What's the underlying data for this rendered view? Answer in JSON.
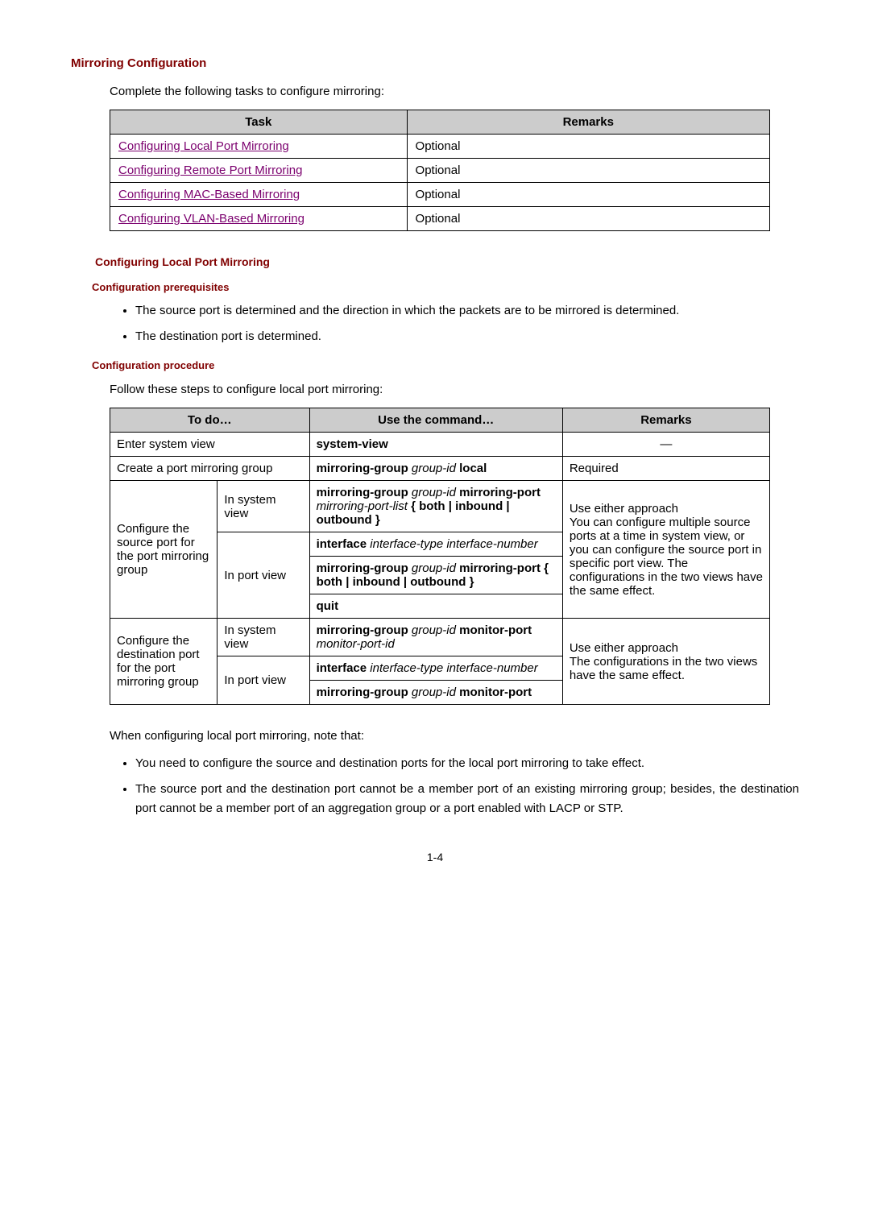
{
  "heading_config": "Mirroring Configuration",
  "intro": "Complete the following tasks to configure mirroring:",
  "tasks_table": {
    "headers": {
      "task": "Task",
      "remarks": "Remarks"
    },
    "rows": [
      {
        "task": "Configuring Local Port Mirroring",
        "remarks": "Optional"
      },
      {
        "task": "Configuring Remote Port Mirroring",
        "remarks": "Optional"
      },
      {
        "task": "Configuring MAC-Based Mirroring",
        "remarks": "Optional"
      },
      {
        "task": "Configuring VLAN-Based Mirroring",
        "remarks": "Optional"
      }
    ]
  },
  "section_local": "Configuring Local Port Mirroring",
  "prereq_heading": "Configuration prerequisites",
  "prereq_bullets": [
    "The source port is determined and the direction in which the packets are to be mirrored is determined.",
    "The destination port is determined."
  ],
  "procedure_heading": "Configuration procedure",
  "follow_text": "Follow these steps to configure local port mirroring:",
  "steps_table": {
    "headers": {
      "todo": "To do…",
      "command": "Use the command…",
      "remarks": "Remarks"
    },
    "row_enter": {
      "todo": "Enter system view",
      "cmd_kw": "system-view",
      "remarks": "—"
    },
    "row_create": {
      "todo": "Create a port mirroring group",
      "cmd_kw1": "mirroring-group",
      "cmd_arg1": "group-id",
      "cmd_kw2": "local",
      "remarks": "Required"
    },
    "row_src": {
      "todo": "Configure the source port for the port mirroring group",
      "sys_view": "In system view",
      "port_view": "In port view",
      "sys_cmd": {
        "kw1": "mirroring-group",
        "arg1": "group-id",
        "kw2": "mirroring-port",
        "arg2": "mirroring-port-list",
        "tail": "{ both | inbound | outbound }"
      },
      "port_iface": {
        "kw": "interface",
        "arg": "interface-type interface-number"
      },
      "port_cmd": {
        "kw1": "mirroring-group",
        "arg1": "group-id",
        "kw2": "mirroring-port",
        "tail": "{ both | inbound | outbound }"
      },
      "quit": "quit",
      "remarks": "Use either approach\nYou can configure multiple source ports at a time in system view, or you can configure the source port in specific port view. The configurations in the two views have the same effect."
    },
    "row_dst": {
      "todo": "Configure the destination port for the port mirroring group",
      "sys_view": "In system view",
      "port_view": "In port view",
      "sys_cmd": {
        "kw1": "mirroring-group",
        "arg1": "group-id",
        "kw2": "monitor-port",
        "arg2": "monitor-port-id"
      },
      "port_iface": {
        "kw": "interface",
        "arg": "interface-type interface-number"
      },
      "port_cmd": {
        "kw1": "mirroring-group",
        "arg1": "group-id",
        "kw2": "monitor-port"
      },
      "remarks": "Use either approach\nThe configurations in the two views have the same effect."
    }
  },
  "note_intro": "When configuring local port mirroring, note that:",
  "note_bullets": [
    "You need to configure the source and destination ports for the local port mirroring to take effect.",
    "The source port and the destination port cannot be a member port of an existing mirroring group; besides, the destination port cannot be a member port of an aggregation group or a port enabled with LACP or STP."
  ],
  "page_num": "1-4"
}
